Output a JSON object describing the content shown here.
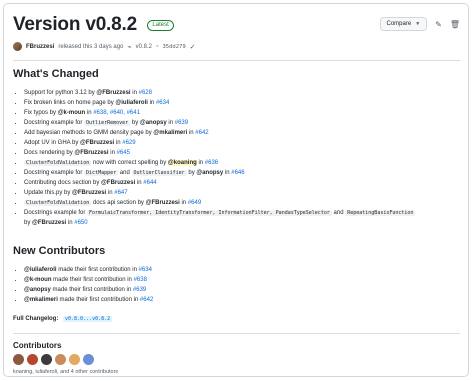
{
  "release": {
    "title": "Version v0.8.2",
    "badge": "Latest",
    "compare_label": "Compare",
    "author": "FBruzzesi",
    "released_text": "released this 3 days ago",
    "tag": "v0.8.2",
    "commit": "35dd279"
  },
  "whats_changed": {
    "heading": "What's Changed",
    "items": [
      {
        "pre": "Support for python 3.12 by ",
        "user": "@FBruzzesi",
        "mid": " in ",
        "link": "#628"
      },
      {
        "pre": "Fix broken links on home page by ",
        "user": "@iuliaferoli",
        "mid": " in ",
        "link": "#634"
      },
      {
        "pre": "Fix typos by ",
        "user": "@k-moun",
        "mid": " in ",
        "link": "#638, #640, #641"
      },
      {
        "pre": "Docstring example for ",
        "code1": "OutlierRemover",
        "pre2": " by ",
        "user": "@anopsy",
        "mid": " in ",
        "link": "#639"
      },
      {
        "pre": "Add bayesian methods to GMM density page by ",
        "user": "@mkalimeri",
        "mid": " in ",
        "link": "#642"
      },
      {
        "pre": "Adopt UV in GHA by ",
        "user": "@FBruzzesi",
        "mid": " in ",
        "link": "#629"
      },
      {
        "pre": "Docs rendering by ",
        "user": "@FBruzzesi",
        "mid": " in ",
        "link": "#645"
      },
      {
        "code1": "ClusterFoldValidation",
        "pre2": " now with correct spelling by ",
        "user": "@koaning",
        "mid": " in ",
        "link": "#636"
      },
      {
        "pre": "Docstring example for ",
        "code1": "DictMapper",
        "between": " and ",
        "code2": "OutlierClassifier",
        "pre2": " by ",
        "user": "@anopsy",
        "mid": " in ",
        "link": "#646"
      },
      {
        "pre": "Contributing docs section by ",
        "user": "@FBruzzesi",
        "mid": " in ",
        "link": "#644"
      },
      {
        "pre": "Update this.py by ",
        "user": "@FBruzzesi",
        "mid": " in ",
        "link": "#647"
      },
      {
        "code1": "ClusterFoldValidation",
        "pre2": " docs api section by ",
        "user": "@FBruzzesi",
        "mid": " in ",
        "link": "#649"
      },
      {
        "pre": "Docstrings example for ",
        "codes": "FormulaicTransformer, IdentityTransformer, InformationFilter, PandasTypeSelector",
        "between": " and ",
        "code2": "RepeatingBasisFunction",
        "pre2": " by ",
        "user": "@FBruzzesi",
        "mid": " in ",
        "link": "#650"
      }
    ]
  },
  "new_contributors": {
    "heading": "New Contributors",
    "items": [
      {
        "user": "@iuliaferoli",
        "text": " made their first contribution in ",
        "link": "#634"
      },
      {
        "user": "@k-moun",
        "text": " made their first contribution in ",
        "link": "#638"
      },
      {
        "user": "@anopsy",
        "text": " made their first contribution in ",
        "link": "#639"
      },
      {
        "user": "@mkalimeri",
        "text": " made their first contribution in ",
        "link": "#642"
      }
    ]
  },
  "changelog": {
    "label": "Full Changelog:",
    "link": "v0.8.0...v0.8.2"
  },
  "contributors": {
    "heading": "Contributors",
    "names": "koaning, iuliaferoli, and 4 other contributors",
    "avatar_colors": [
      "#8b5a3c",
      "#b6462f",
      "#3b3b3b",
      "#c98b5b",
      "#e2a95f",
      "#6b8fd6"
    ]
  },
  "icons": {
    "edit": "pencil-icon",
    "delete": "trash-icon",
    "tag": "tag-icon",
    "commit": "commit-icon",
    "verified": "check-circle-icon"
  }
}
